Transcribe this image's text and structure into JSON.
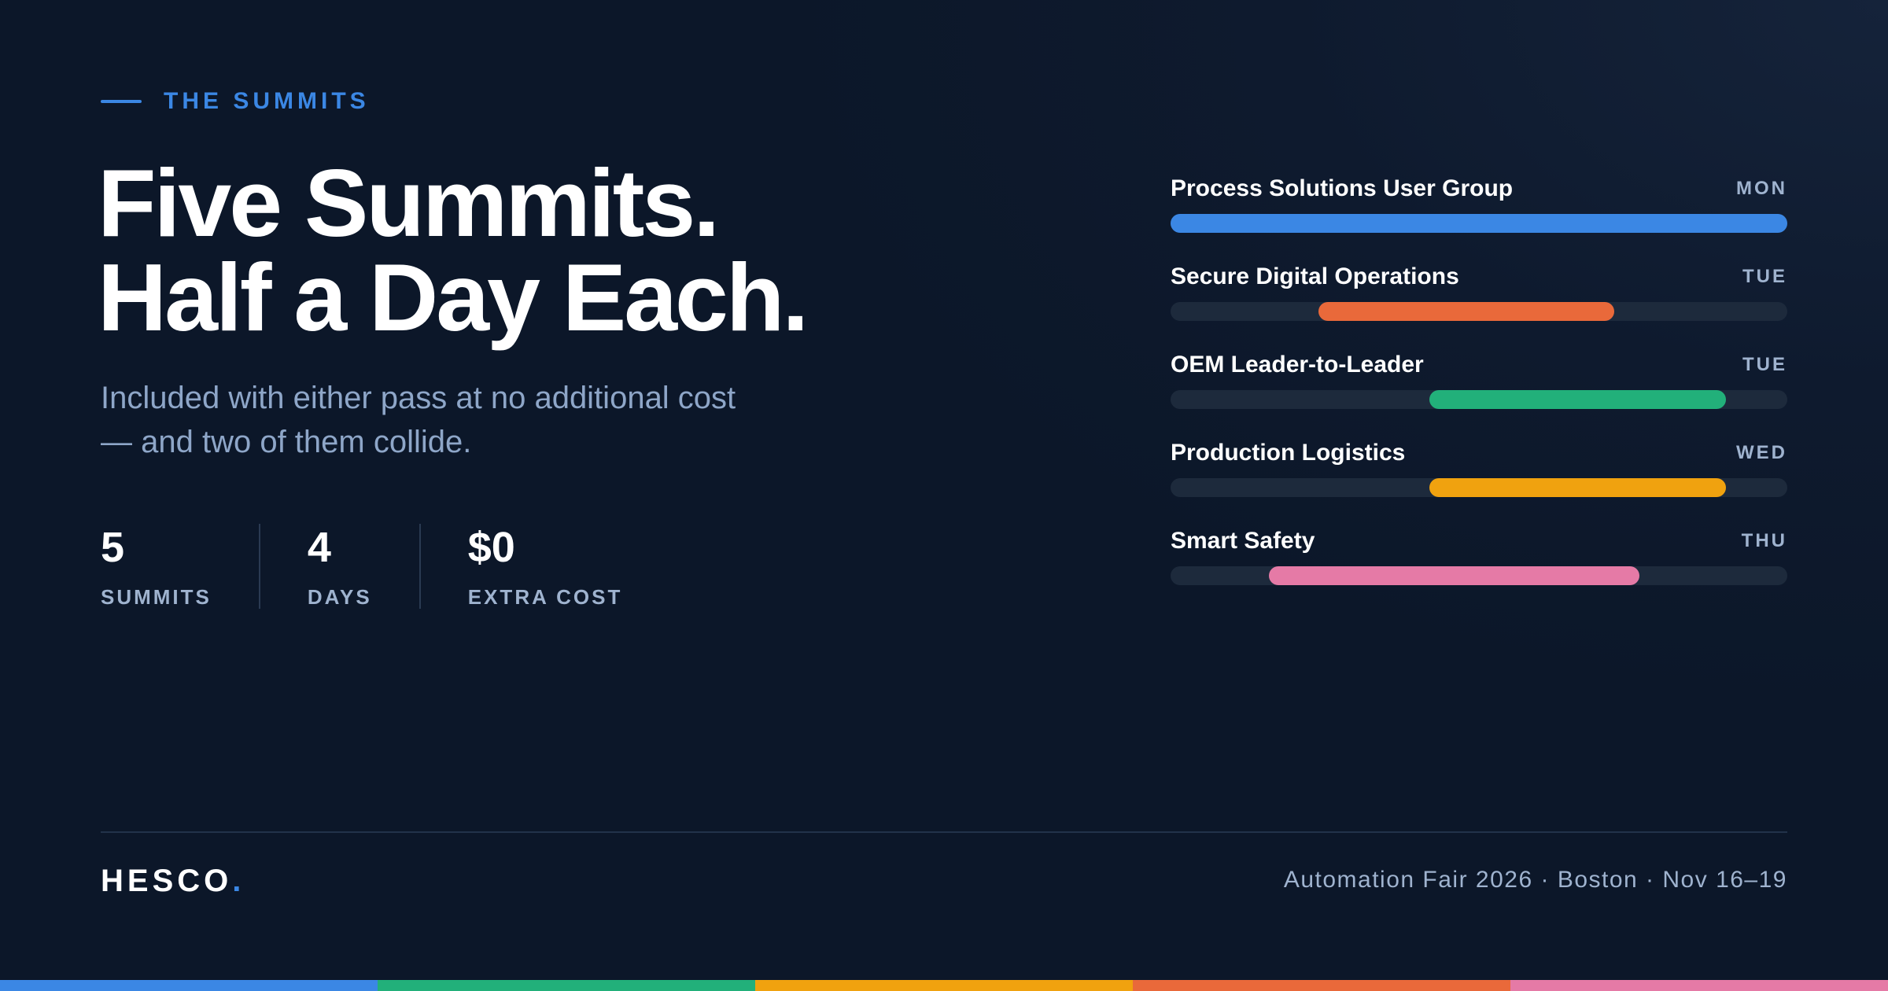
{
  "colors": {
    "accent_blue": "#3b87e4",
    "orange": "#e9693a",
    "green": "#22b07a",
    "amber": "#f0a20f",
    "pink": "#e57aa6"
  },
  "eyebrow": {
    "text": "THE SUMMITS"
  },
  "headline": {
    "line1": "Five Summits.",
    "line2": "Half a Day Each."
  },
  "subhead": {
    "line1": "Included with either pass at no additional cost",
    "line2": "— and two of them collide."
  },
  "stats": [
    {
      "value": "5",
      "label": "SUMMITS"
    },
    {
      "value": "4",
      "label": "DAYS"
    },
    {
      "value": "$0",
      "label": "EXTRA COST"
    }
  ],
  "summits": [
    {
      "name": "Process Solutions User Group",
      "day": "MON",
      "color": "#3b87e4",
      "start": 0.0,
      "end": 1.0
    },
    {
      "name": "Secure Digital Operations",
      "day": "TUE",
      "color": "#e9693a",
      "start": 0.24,
      "end": 0.72
    },
    {
      "name": "OEM Leader-to-Leader",
      "day": "TUE",
      "color": "#22b07a",
      "start": 0.42,
      "end": 0.9
    },
    {
      "name": "Production Logistics",
      "day": "WED",
      "color": "#f0a20f",
      "start": 0.42,
      "end": 0.9
    },
    {
      "name": "Smart Safety",
      "day": "THU",
      "color": "#e57aa6",
      "start": 0.16,
      "end": 0.76
    }
  ],
  "footer": {
    "logo": "HESCO",
    "logo_dot": ".",
    "event_info": "Automation Fair 2026 · Boston · Nov 16–19"
  },
  "color_strip": [
    "#3b87e4",
    "#22b07a",
    "#f0a20f",
    "#e9693a",
    "#e57aa6"
  ]
}
